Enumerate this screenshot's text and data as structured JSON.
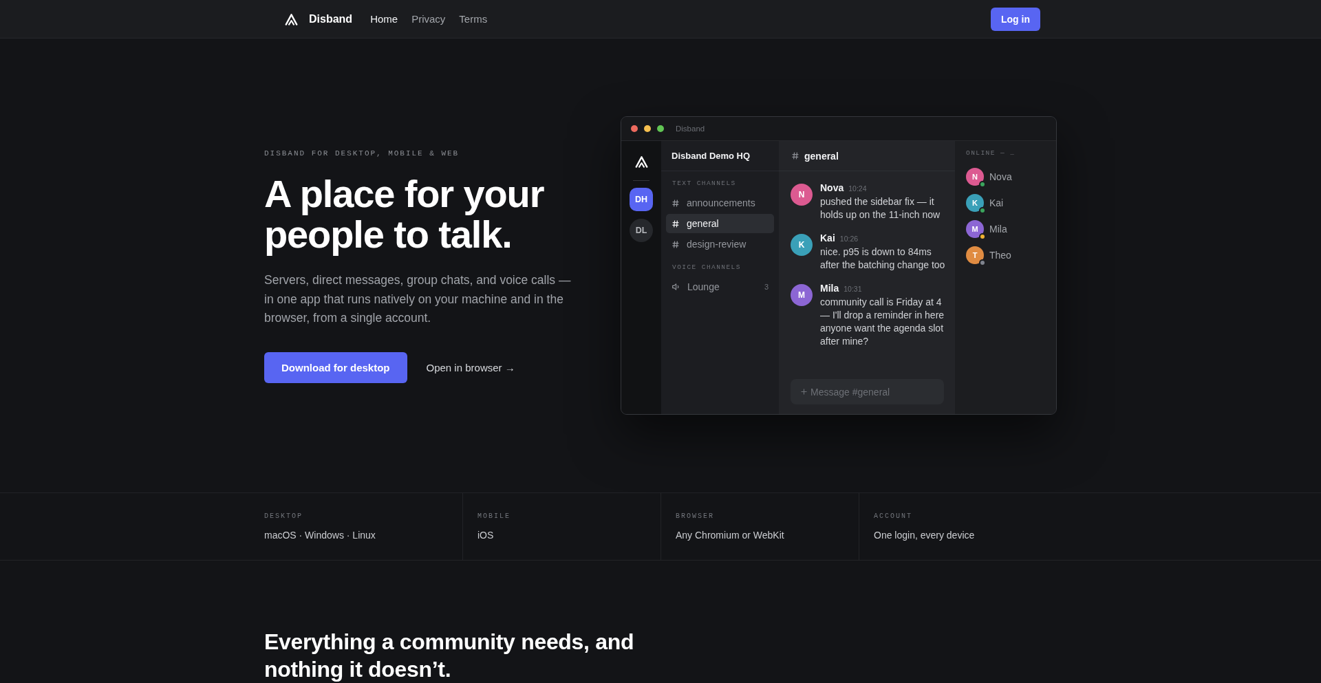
{
  "nav": {
    "brand": "Disband",
    "links": [
      {
        "label": "Home",
        "selected": true
      },
      {
        "label": "Privacy",
        "selected": false
      },
      {
        "label": "Terms",
        "selected": false
      }
    ],
    "login_button": "Log in"
  },
  "hero": {
    "eyebrow": "DISBAND FOR DESKTOP, MOBILE & WEB",
    "heading": "A place for your people to talk.",
    "description": "Servers, direct messages, group chats, and voice calls — in one app that runs natively on your machine and in the browser, from a single account.",
    "primary_button": "Download for desktop",
    "secondary_link": "Open in browser →"
  },
  "app_window": {
    "title": "Disband",
    "servers": [
      {
        "initials": "DH",
        "selected": true
      },
      {
        "initials": "DL",
        "selected": false
      }
    ],
    "server_name": "Disband Demo HQ",
    "channel_groups": [
      {
        "label": "TEXT CHANNELS",
        "channels": [
          {
            "kind": "text",
            "name": "announcements",
            "selected": false
          },
          {
            "kind": "text",
            "name": "general",
            "selected": true
          },
          {
            "kind": "text",
            "name": "design-review",
            "selected": false
          }
        ]
      },
      {
        "label": "VOICE CHANNELS",
        "channels": [
          {
            "kind": "voice",
            "name": "Lounge",
            "count": "3",
            "selected": false
          }
        ]
      }
    ],
    "channel_header": "general",
    "messages": [
      {
        "author": "Nova",
        "initial": "N",
        "color": "#dc5a91",
        "time": "10:24",
        "text": "pushed the sidebar fix — it holds up on the 11-inch now"
      },
      {
        "author": "Kai",
        "initial": "K",
        "color": "#3aa0b8",
        "time": "10:26",
        "text": "nice. p95 is down to 84ms after the batching change too"
      },
      {
        "author": "Mila",
        "initial": "M",
        "color": "#8c66d4",
        "time": "10:31",
        "text": "community call is Friday at 4 — I'll drop a reminder in here anyone want the agenda slot after mine?"
      }
    ],
    "composer": {
      "placeholder": "Message #general"
    },
    "members_heading": "ONLINE — …",
    "members": [
      {
        "name": "Nova",
        "initial": "N",
        "color": "#dc5a91",
        "status": {
          "color": "#3ba55d"
        }
      },
      {
        "name": "Kai",
        "initial": "K",
        "color": "#3aa0b8",
        "status": {
          "color": "#3ba55d"
        }
      },
      {
        "name": "Mila",
        "initial": "M",
        "color": "#8c66d4",
        "status": {
          "color": "#f0b232"
        }
      },
      {
        "name": "Theo",
        "initial": "T",
        "color": "#e08c42",
        "status": {
          "color": "#80848e"
        }
      }
    ]
  },
  "platforms": [
    {
      "label": "DESKTOP",
      "value": "macOS · Windows · Linux"
    },
    {
      "label": "MOBILE",
      "value": "iOS"
    },
    {
      "label": "BROWSER",
      "value": "Any Chromium or WebKit"
    },
    {
      "label": "ACCOUNT",
      "value": "One login, every device"
    }
  ],
  "features": {
    "heading": "Everything a community needs, and nothing it doesn’t."
  }
}
